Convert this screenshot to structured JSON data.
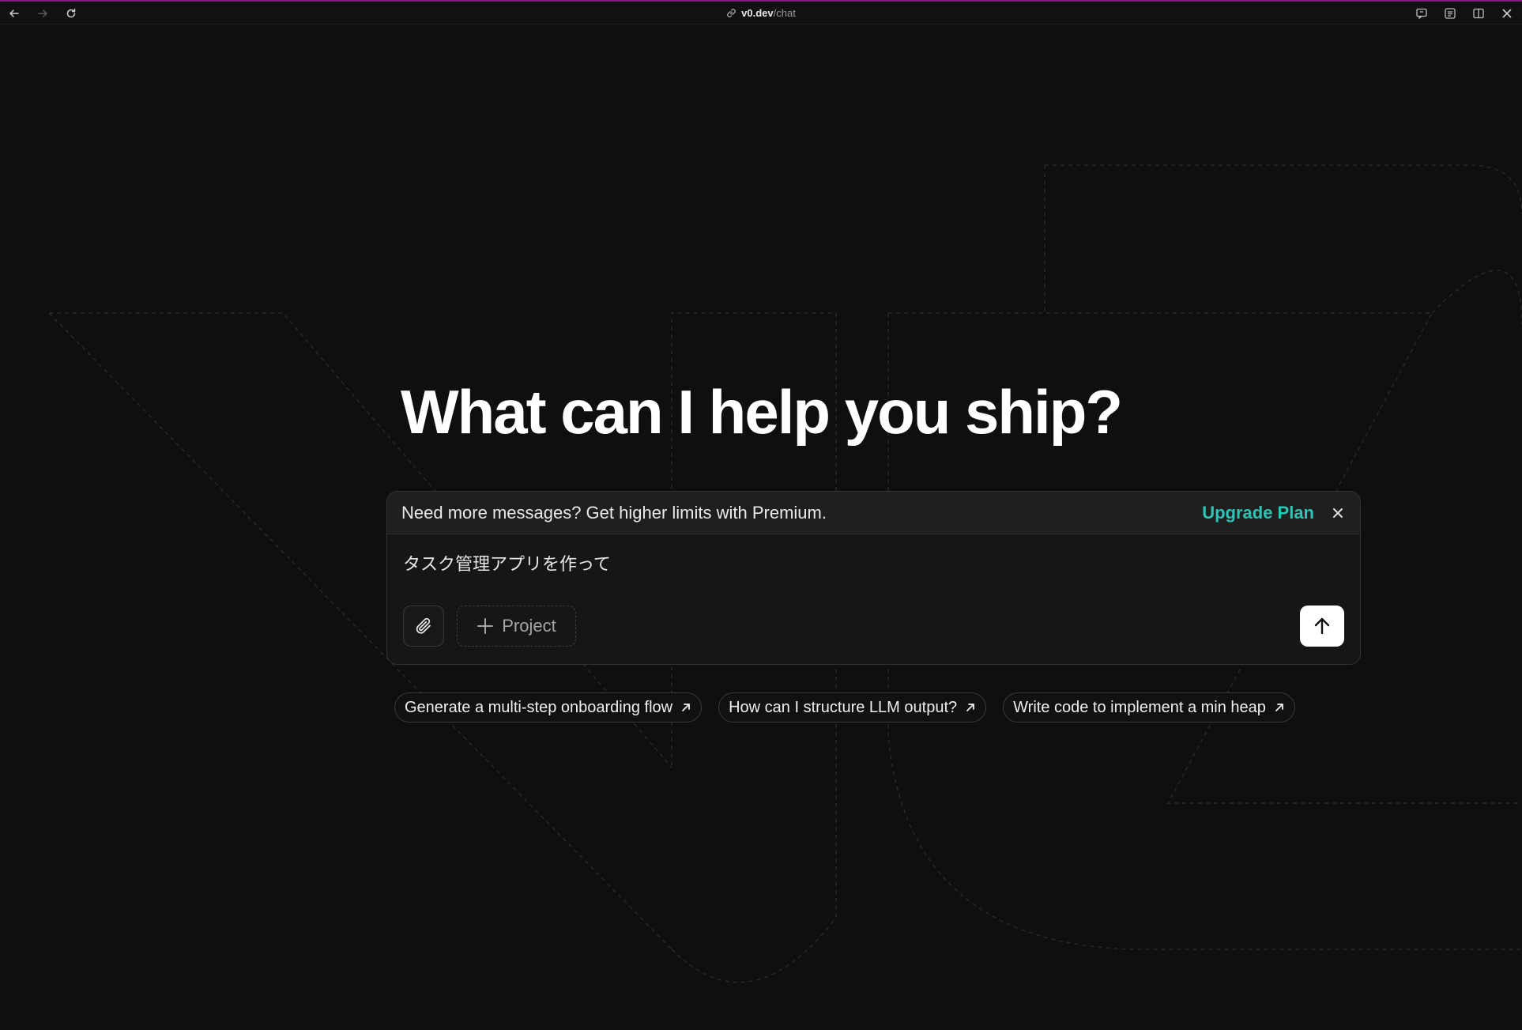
{
  "browser": {
    "url_host": "v0.dev",
    "url_path": "/chat",
    "icons": [
      "back-arrow-icon",
      "forward-arrow-icon",
      "reload-icon",
      "link-icon",
      "chat-icon",
      "list-icon",
      "split-view-icon",
      "close-icon"
    ]
  },
  "hero": {
    "headline": "What can I help you ship?"
  },
  "banner": {
    "message": "Need more messages? Get higher limits with Premium.",
    "upgrade_label": "Upgrade Plan",
    "accent_color": "#2ec4b6"
  },
  "composer": {
    "prompt_value": "タスク管理アプリを作って",
    "project_label": "Project"
  },
  "suggestions": [
    {
      "label": "Generate a multi-step onboarding flow"
    },
    {
      "label": "How can I structure LLM output?"
    },
    {
      "label": "Write code to implement a min heap"
    }
  ]
}
